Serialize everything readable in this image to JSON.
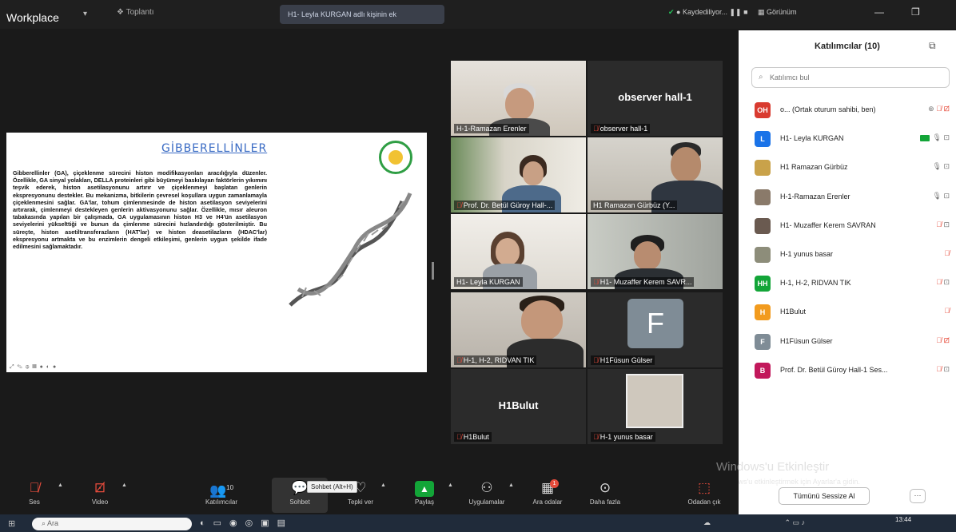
{
  "title_bar": {
    "app_name": "Workplace",
    "meeting_label": "Toplantı",
    "active_tab": "H1- Leyla KURGAN adlı kişinin ek",
    "status": "Kaydediliyor...",
    "view_label": "Görünüm"
  },
  "slide": {
    "title": "GİBBERELLİNLER",
    "body": "Gibberellinler (GA), çiçeklenme sürecini histon modifikasyonları aracılığıyla düzenler. Özellikle, GA sinyal yolakları, DELLA proteinleri gibi büyümeyi baskılayan faktörlerin yıkımını teşvik ederek, histon asetilasyonunu artırır ve çiçeklenmeyi başlatan genlerin ekspresyonunu destekler. Bu mekanizma, bitkilerin çevresel koşullara uygun zamanlamayla çiçeklenmesini sağlar. GA'lar, tohum çimlenmesinde de histon asetilasyon seviyelerini artırarak, çimlenmeyi destekleyen genlerin aktivasyonunu sağlar. Özellikle, mısır aleuron tabakasında yapılan bir çalışmada, GA uygulamasının histon H3 ve H4'ün asetilasyon seviyelerini yükselttiği ve bunun da çimlenme sürecini hızlandırdığı gösterilmiştir. Bu süreçte, histon asetiltransferazların (HAT'lar) ve histon deasetilazların (HDAC'lar) ekspresyonu artmakta ve bu enzimlerin dengeli etkileşimi, genlerin uygun şekilde ifade edilmesini sağlamaktadır.",
    "tools": "⤢ ✎ ⊕ ▦ ● ◐ ●"
  },
  "videos": [
    {
      "name": "H-1-Ramazan Erenler",
      "muted": false
    },
    {
      "name": "observer hall-1",
      "muted": true,
      "big_label": "observer hall-1"
    },
    {
      "name": "Prof. Dr. Betül Güroy  Hall-...",
      "muted": true
    },
    {
      "name": "H1 Ramazan Gürbüz (Y...",
      "muted": false
    },
    {
      "name": "H1- Leyla KURGAN",
      "muted": false
    },
    {
      "name": "H1- Muzaffer Kerem SAVR...",
      "muted": true
    },
    {
      "name": "H-1, H-2, RIDVAN TIK",
      "muted": true
    },
    {
      "name": "H1Füsun Gülser",
      "muted": true,
      "avatar": "F"
    },
    {
      "name": "H1Bulut",
      "muted": true,
      "big_label": "H1Bulut"
    },
    {
      "name": "H-1 yunus basar",
      "muted": true
    }
  ],
  "panel": {
    "title": "Katılımcılar (10)",
    "search_placeholder": "Katılımcı bul",
    "participants": [
      {
        "initials": "OH",
        "color": "#d93b30",
        "name": "o... (Ortak oturum sahibi, ben)",
        "status": "muted"
      },
      {
        "initials": "L",
        "color": "#1a73e8",
        "name": "H1- Leyla KURGAN",
        "status": "sharing"
      },
      {
        "initials": "",
        "color": "#c9a24a",
        "name": "H1 Ramazan Gürbüz",
        "status": "unmuted"
      },
      {
        "initials": "",
        "color": "#8a7a6a",
        "name": "H-1-Ramazan Erenler",
        "status": "unmuted"
      },
      {
        "initials": "",
        "color": "#6a5a50",
        "name": "H1- Muzaffer Kerem SAVRAN",
        "status": "muted"
      },
      {
        "initials": "",
        "color": "#8d8d7a",
        "name": "H-1 yunus basar",
        "status": "muted_only"
      },
      {
        "initials": "HH",
        "color": "#13a538",
        "name": "H-1, H-2, RIDVAN TIK",
        "status": "muted"
      },
      {
        "initials": "H",
        "color": "#f29b1e",
        "name": "H1Bulut",
        "status": "muted_only"
      },
      {
        "initials": "F",
        "color": "#7f8c96",
        "name": "H1Füsun Gülser",
        "status": "muted_cam"
      },
      {
        "initials": "B",
        "color": "#c2185b",
        "name": "Prof. Dr. Betül Güroy  Hall-1 Ses...",
        "status": "muted"
      }
    ],
    "mute_all_label": "Tümünü Sessize Al",
    "more_label": "···"
  },
  "watermark": {
    "line1": "Windows'u Etkinleştir",
    "line2": "Windows'u etkinleştirmek için Ayarlar'a gidin."
  },
  "toolbar": {
    "buttons": [
      {
        "id": "ses",
        "label": "Ses",
        "icon": "🎤"
      },
      {
        "id": "video",
        "label": "Video",
        "icon": "📹"
      },
      {
        "id": "katilimcilar",
        "label": "Katılımcılar",
        "icon": "👥",
        "count": "10"
      },
      {
        "id": "sohbet",
        "label": "Sohbet",
        "icon": "💬"
      },
      {
        "id": "tepki",
        "label": "Tepki ver",
        "icon": "♡"
      },
      {
        "id": "paylas",
        "label": "Paylaş",
        "icon": "▲"
      },
      {
        "id": "uygulamalar",
        "label": "Uygulamalar",
        "icon": "⚇"
      },
      {
        "id": "ara-odalar",
        "label": "Ara odalar",
        "icon": "▦"
      },
      {
        "id": "daha-fazla",
        "label": "Daha fazla",
        "icon": "···"
      },
      {
        "id": "odadan-cik",
        "label": "Odadan çık",
        "icon": "⬚"
      }
    ],
    "tooltip": "Sohbet (Alt+H)",
    "badge": "1"
  },
  "taskbar": {
    "search_placeholder": "Ara",
    "time": "13:44"
  }
}
